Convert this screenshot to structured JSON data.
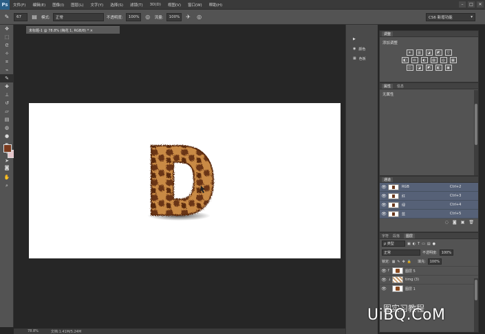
{
  "app": {
    "logo": "Ps"
  },
  "menu": [
    "文件(F)",
    "编辑(E)",
    "图像(I)",
    "图层(L)",
    "文字(Y)",
    "选择(S)",
    "滤镜(T)",
    "3D(D)",
    "视图(V)",
    "窗口(W)",
    "帮助(H)"
  ],
  "window_controls": [
    "–",
    "□",
    "✕"
  ],
  "options_bar": {
    "brush_size": "67",
    "mode_label": "模式:",
    "mode_value": "正常",
    "opacity_label": "不透明度:",
    "opacity_value": "100%",
    "flow_label": "流量:",
    "flow_value": "100%",
    "workspace": "CS6 新增功能"
  },
  "document": {
    "tab_title": "未标题-1 @ 78.8% (梅花 1, RGB/8) * ×",
    "zoom": "78.8%",
    "doc_info": "文档:1.41M/5.24M"
  },
  "mini_strip": {
    "items": [
      {
        "icon": "▶",
        "label": ""
      },
      {
        "icon": "◉",
        "label": "颜色"
      },
      {
        "icon": "▦",
        "label": "色板"
      }
    ]
  },
  "adjustments_panel": {
    "tabs": [
      "调整"
    ],
    "title": "添加调整",
    "row1": [
      "☀",
      "▥",
      "◪",
      "◩",
      "▽"
    ],
    "row2": [
      "◧",
      "⚖",
      "◐",
      "▨",
      "◎",
      "▦"
    ],
    "row3": [
      "◫",
      "◪",
      "◩",
      "◧",
      "▣"
    ]
  },
  "properties_panel": {
    "tabs": [
      "属性",
      "信息"
    ],
    "text": "无属性"
  },
  "channels_panel": {
    "tabs": [
      "通道"
    ],
    "channels": [
      {
        "name": "RGB",
        "shortcut": "Ctrl+2"
      },
      {
        "name": "红",
        "shortcut": "Ctrl+3"
      },
      {
        "name": "绿",
        "shortcut": "Ctrl+4"
      },
      {
        "name": "蓝",
        "shortcut": "Ctrl+5"
      }
    ]
  },
  "layers_panel": {
    "tabs": [
      "字符",
      "段落",
      "图层"
    ],
    "kind_filter": "ρ 类型",
    "blend_mode": "正常",
    "opacity_label": "不透明度:",
    "opacity_value": "100%",
    "lock_label": "锁定:",
    "fill_label": "填充:",
    "fill_value": "100%",
    "layers": [
      {
        "name": "图层 5",
        "has_fx": true
      },
      {
        "name": "timg (3)",
        "has_fx": false
      },
      {
        "name": "图层 1",
        "has_fx": false
      }
    ]
  },
  "watermark": {
    "brand": "UiBQ.CoM",
    "sub": "图实习教程"
  }
}
